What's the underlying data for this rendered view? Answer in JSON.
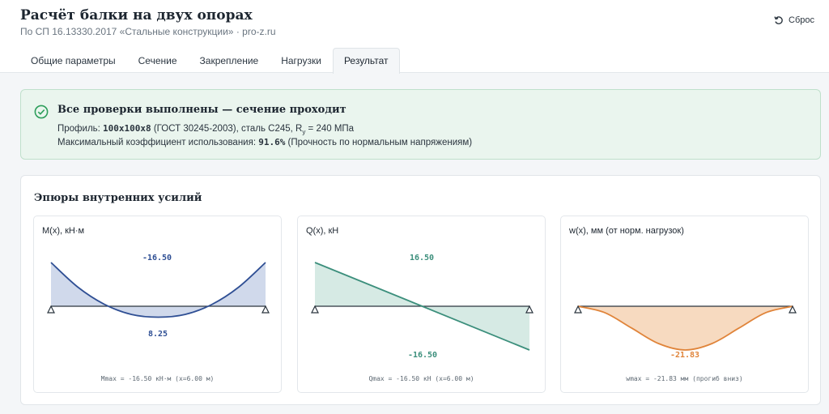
{
  "header": {
    "title": "Расчёт балки на двух опорах",
    "subtitle": "По СП 16.13330.2017 «Стальные конструкции» · pro-z.ru",
    "reset_label": "Сброс"
  },
  "tabs": [
    {
      "label": "Общие параметры",
      "active": false
    },
    {
      "label": "Сечение",
      "active": false
    },
    {
      "label": "Закрепление",
      "active": false
    },
    {
      "label": "Нагрузки",
      "active": false
    },
    {
      "label": "Результат",
      "active": true
    }
  ],
  "alert": {
    "title": "Все проверки выполнены — сечение проходит",
    "profile_prefix": "Профиль: ",
    "profile_value": "100x100x8",
    "profile_suffix_1": " (ГОСТ 30245-2003), сталь С245, R",
    "profile_sub": "y",
    "profile_suffix_2": " = 240 МПа",
    "coef_prefix": "Максимальный коэффициент использования: ",
    "coef_value": "91.6%",
    "coef_suffix": " (Прочность по нормальным напряжениям)",
    "status_color": "#2e9e5b"
  },
  "diagrams_title": "Эпюры внутренних усилий",
  "chart_data": [
    {
      "type": "area",
      "title": "M(x), кН·м",
      "color": "#2f4f94",
      "fill": "#c8d2e8",
      "x": [
        0,
        1.5,
        3,
        4.5,
        6,
        7.5,
        9,
        10.5,
        12
      ],
      "values": [
        -16.5,
        -7.22,
        -0.69,
        3.09,
        4.12,
        3.09,
        -0.69,
        -7.22,
        -16.5
      ],
      "ylim": [
        -16.5,
        8.25
      ],
      "labels": [
        "-16.50",
        "8.25"
      ],
      "footer": "Mmax = -16.50 кН·м (x=6.00 м)"
    },
    {
      "type": "area",
      "title": "Q(x), кН",
      "color": "#3c8f7c",
      "fill": "#cfe6df",
      "x": [
        0,
        6,
        12
      ],
      "values": [
        16.5,
        0,
        -16.5
      ],
      "ylim": [
        -16.5,
        16.5
      ],
      "labels": [
        "16.50",
        "-16.50"
      ],
      "footer": "Qmax = -16.50 кН (x=6.00 м)"
    },
    {
      "type": "area",
      "title": "w(x), мм (от норм. нагрузок)",
      "color": "#e0843a",
      "fill": "#f6d3b5",
      "x": [
        0,
        1.5,
        3,
        4.5,
        6,
        7.5,
        9,
        10.5,
        12
      ],
      "values": [
        0,
        -3.2,
        -10.9,
        -18.6,
        -21.83,
        -18.6,
        -10.9,
        -3.2,
        0
      ],
      "ylim": [
        -21.83,
        0
      ],
      "labels": [
        "-21.83"
      ],
      "footer": "wmax = -21.83 мм (прогиб вниз)"
    }
  ]
}
